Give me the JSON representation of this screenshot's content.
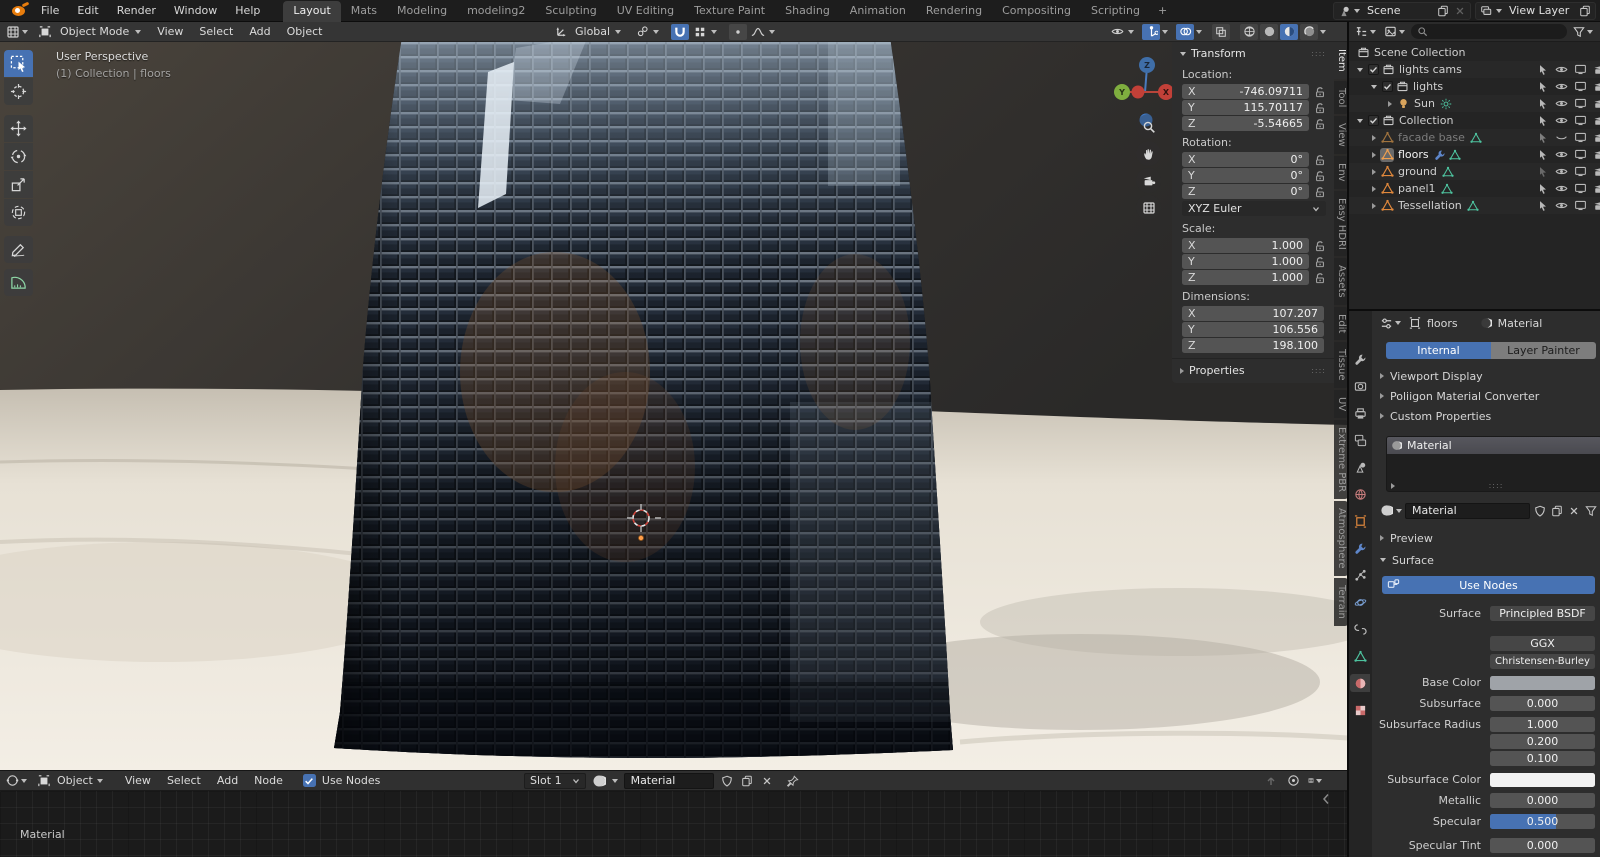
{
  "topbar": {
    "menus": [
      {
        "label": "File"
      },
      {
        "label": "Edit"
      },
      {
        "label": "Render"
      },
      {
        "label": "Window"
      },
      {
        "label": "Help"
      }
    ],
    "workspaces": [
      {
        "label": "Layout"
      },
      {
        "label": "Mats"
      },
      {
        "label": "Modeling"
      },
      {
        "label": "modeling2"
      },
      {
        "label": "Sculpting"
      },
      {
        "label": "UV Editing"
      },
      {
        "label": "Texture Paint"
      },
      {
        "label": "Shading"
      },
      {
        "label": "Animation"
      },
      {
        "label": "Rendering"
      },
      {
        "label": "Compositing"
      },
      {
        "label": "Scripting"
      }
    ],
    "active_workspace": "Layout",
    "add_workspace": "+",
    "scene_name": "Scene",
    "view_layer_name": "View Layer"
  },
  "viewport_header": {
    "mode": "Object Mode",
    "view": "View",
    "select": "Select",
    "add": "Add",
    "object": "Object",
    "orientation": "Global"
  },
  "viewport": {
    "perspective_label": "User Perspective",
    "context_label": "(1) Collection | floors",
    "axis_x": "X",
    "axis_y": "Y",
    "axis_z": "Z"
  },
  "sidebar_tabs": [
    {
      "label": "Item"
    },
    {
      "label": "Tool"
    },
    {
      "label": "View"
    },
    {
      "label": "Env"
    },
    {
      "label": "Easy HDRI"
    },
    {
      "label": "Assets"
    },
    {
      "label": "Edit"
    },
    {
      "label": "Tissue"
    },
    {
      "label": "UV"
    },
    {
      "label": "Extreme PBR"
    },
    {
      "label": "Atmosphere"
    },
    {
      "label": "Terrain"
    }
  ],
  "active_sidebar_tab": "Item",
  "transform": {
    "title": "Transform",
    "location_label": "Location:",
    "loc": [
      {
        "axis": "X",
        "value": "-746.09711"
      },
      {
        "axis": "Y",
        "value": "115.70117"
      },
      {
        "axis": "Z",
        "value": "-5.54665"
      }
    ],
    "rotation_label": "Rotation:",
    "rot": [
      {
        "axis": "X",
        "value": "0°"
      },
      {
        "axis": "Y",
        "value": "0°"
      },
      {
        "axis": "Z",
        "value": "0°"
      }
    ],
    "rotation_mode": "XYZ Euler",
    "scale_label": "Scale:",
    "scl": [
      {
        "axis": "X",
        "value": "1.000"
      },
      {
        "axis": "Y",
        "value": "1.000"
      },
      {
        "axis": "Z",
        "value": "1.000"
      }
    ],
    "dimensions_label": "Dimensions:",
    "dim": [
      {
        "axis": "X",
        "value": "107.207"
      },
      {
        "axis": "Y",
        "value": "106.556"
      },
      {
        "axis": "Z",
        "value": "198.100"
      }
    ],
    "properties_label": "Properties"
  },
  "outliner": {
    "rows": [
      {
        "label": "Scene Collection"
      },
      {
        "label": "lights cams"
      },
      {
        "label": "lights"
      },
      {
        "label": "Sun"
      },
      {
        "label": "Collection"
      },
      {
        "label": "facade base"
      },
      {
        "label": "floors"
      },
      {
        "label": "ground"
      },
      {
        "label": "panel1"
      },
      {
        "label": "Tessellation"
      }
    ]
  },
  "properties": {
    "breadcrumb_object": "floors",
    "breadcrumb_material": "Material",
    "tab_internal": "Internal",
    "tab_layer_painter": "Layer Painter",
    "panel_viewport_display": "Viewport Display",
    "panel_poliigon": "Poliigon Material Converter",
    "panel_custom_props": "Custom Properties",
    "slot_material": "Material",
    "material_name": "Material",
    "preview_label": "Preview",
    "surface_panel_label": "Surface",
    "use_nodes_label": "Use Nodes",
    "surface_label": "Surface",
    "surface_value": "Principled BSDF",
    "ggx": "GGX",
    "christensen": "Christensen-Burley",
    "base_color_label": "Base Color",
    "subsurface_label": "Subsurface",
    "subsurface_value": "0.000",
    "ss_radius_label": "Subsurface Radius",
    "ss_radius_values": [
      "1.000",
      "0.200",
      "0.100"
    ],
    "ss_color_label": "Subsurface Color",
    "metallic_label": "Metallic",
    "metallic_value": "0.000",
    "specular_label": "Specular",
    "specular_value": "0.500",
    "specular_tint_label": "Specular Tint",
    "specular_tint_value": "0.000",
    "colors": {
      "accent": "#4772b3",
      "base_color_swatch": "#9fa3a8",
      "subsurface_color_swatch": "#f2f2f2"
    }
  },
  "shader": {
    "type_label": "Object",
    "view": "View",
    "select": "Select",
    "add": "Add",
    "node": "Node",
    "use_nodes": "Use Nodes",
    "slot": "Slot 1",
    "material_name": "Material",
    "node_caption": "Material"
  }
}
